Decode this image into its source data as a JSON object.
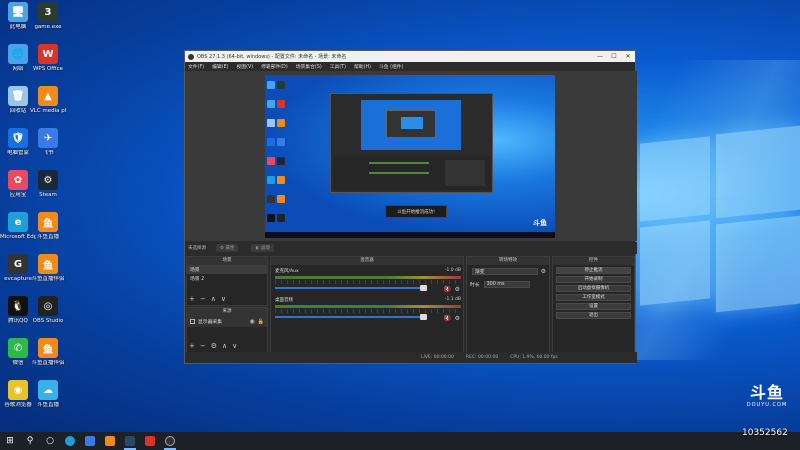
{
  "desktop": {
    "icons_left": [
      {
        "label": "此电脑",
        "color": "#4aa3e8",
        "glyph": "🖥"
      },
      {
        "label": "网络",
        "color": "#4aa3e8",
        "glyph": "🌐"
      },
      {
        "label": "回收站",
        "color": "#9cc5e6",
        "glyph": "🗑"
      },
      {
        "label": "电脑管家",
        "color": "#1a6fe0",
        "glyph": "🛡"
      },
      {
        "label": "应用宝",
        "color": "#e84a5f",
        "glyph": "✿"
      },
      {
        "label": "Microsoft Edge",
        "color": "#1f9fd8",
        "glyph": "e"
      },
      {
        "label": "evcapture",
        "color": "#333333",
        "glyph": "G"
      },
      {
        "label": "腾讯QQ",
        "color": "#111111",
        "glyph": "🐧"
      },
      {
        "label": "微信",
        "color": "#2db84a",
        "glyph": "✆"
      },
      {
        "label": "谷歌浏览器",
        "color": "#e8c32a",
        "glyph": "◉"
      }
    ],
    "icons_right": [
      {
        "label": "game.exe",
        "color": "#2b3a2e",
        "glyph": "3"
      },
      {
        "label": "WPS Office",
        "color": "#d8342a",
        "glyph": "W"
      },
      {
        "label": "VLC media player",
        "color": "#f08a18",
        "glyph": "▲"
      },
      {
        "label": "飞书",
        "color": "#3a7ae8",
        "glyph": "✈"
      },
      {
        "label": "Steam",
        "color": "#1b2838",
        "glyph": "⚙"
      },
      {
        "label": "斗鱼直播",
        "color": "#f08a18",
        "glyph": "鱼"
      },
      {
        "label": "斗鱼直播伴侣",
        "color": "#f08a18",
        "glyph": "鱼"
      },
      {
        "label": "OBS Studio",
        "color": "#222222",
        "glyph": "◎"
      },
      {
        "label": "斗鱼直播伴侣",
        "color": "#f08a18",
        "glyph": "鱼"
      },
      {
        "label": "斗鱼直播",
        "color": "#3ab0e8",
        "glyph": "☁"
      }
    ]
  },
  "obs": {
    "title": "OBS 27.1.3 (64-bit, windows) - 配置文件: 未命名 - 场景: 未命名",
    "menu": [
      "文件(F)",
      "编辑(E)",
      "视图(V)",
      "停靠部件(D)",
      "场景集合(S)",
      "工具(T)",
      "帮助(H)",
      "斗鱼 (组件)"
    ],
    "preview_toast": "斗鱼开始推流成功!",
    "no_source": "未选择源",
    "source_buttons": [
      "属性",
      "滤镜"
    ],
    "docks": {
      "scenes": {
        "title": "场景",
        "items": [
          "场景",
          "场景 2"
        ]
      },
      "sources": {
        "title": "来源",
        "items": [
          {
            "label": "显示器采集"
          }
        ]
      },
      "mixer": {
        "title": "混音器",
        "channels": [
          {
            "name": "麦克风/Aux",
            "db": "-1.0 dB"
          },
          {
            "name": "桌面音频",
            "db": "-1.1 dB"
          }
        ]
      },
      "transitions": {
        "title": "转场特效",
        "type_label": "渐变",
        "duration_label": "时长",
        "duration_value": "300 ms"
      },
      "controls": {
        "title": "控件",
        "buttons": [
          "停止推流",
          "开始录制",
          "启动虚拟摄像机",
          "工作室模式",
          "设置",
          "退出"
        ]
      }
    },
    "status": {
      "live": "LIVE: 00:00:00",
      "rec": "REC: 00:00:00",
      "cpu": "CPU: 1.9%, 60.00 fps"
    }
  },
  "watermark": {
    "logo": "斗鱼",
    "sub": "DOUYU.COM",
    "room_id": "10352562"
  },
  "taskbar": {
    "start": "⊞",
    "search": "⚲",
    "taskview": "○"
  }
}
